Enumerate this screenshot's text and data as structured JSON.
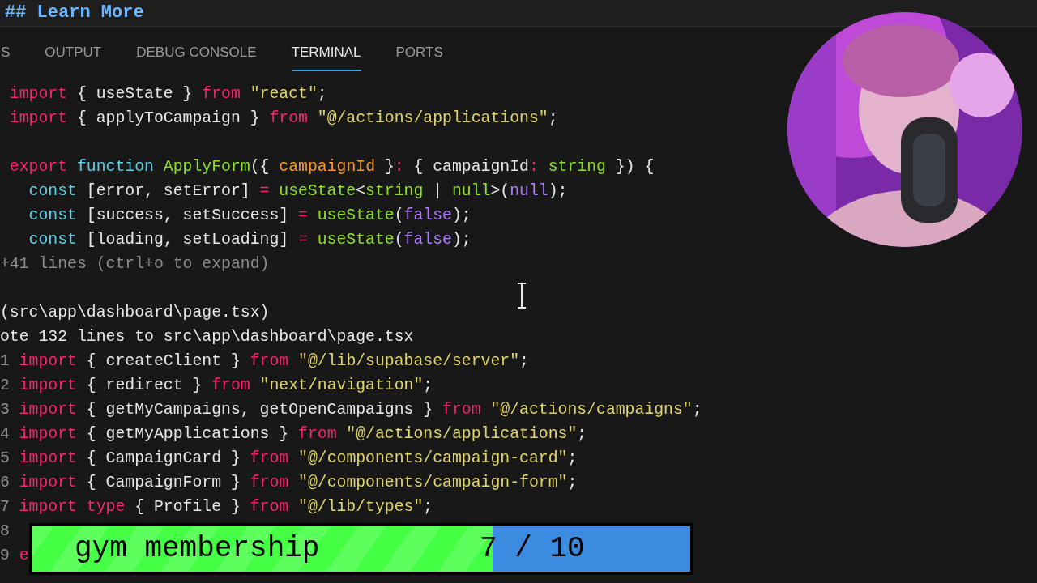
{
  "editor": {
    "heading": "## Learn More"
  },
  "panel": {
    "tabs": [
      {
        "label": "S",
        "selected": false
      },
      {
        "label": "OUTPUT",
        "selected": false
      },
      {
        "label": "DEBUG CONSOLE",
        "selected": false
      },
      {
        "label": "TERMINAL",
        "selected": true
      },
      {
        "label": "PORTS",
        "selected": false
      }
    ]
  },
  "terminal": {
    "lines": [
      {
        "kind": "code",
        "tokens": [
          {
            "kind": "kw",
            "text": " import"
          },
          {
            "kind": "plain",
            "text": " { useState } "
          },
          {
            "kind": "kw",
            "text": "from"
          },
          {
            "kind": "str",
            "text": " \"react\""
          },
          {
            "kind": "plain",
            "text": ";"
          }
        ]
      },
      {
        "kind": "code",
        "tokens": [
          {
            "kind": "kw",
            "text": " import"
          },
          {
            "kind": "plain",
            "text": " { applyToCampaign } "
          },
          {
            "kind": "kw",
            "text": "from"
          },
          {
            "kind": "str",
            "text": " \"@/actions/applications\""
          },
          {
            "kind": "plain",
            "text": ";"
          }
        ]
      },
      {
        "kind": "blank"
      },
      {
        "kind": "code",
        "tokens": [
          {
            "kind": "kw",
            "text": " export"
          },
          {
            "kind": "storage",
            "text": " function"
          },
          {
            "kind": "fn",
            "text": " ApplyForm"
          },
          {
            "kind": "plain",
            "text": "({ "
          },
          {
            "kind": "param",
            "text": "campaignId"
          },
          {
            "kind": "plain",
            "text": " }"
          },
          {
            "kind": "kw",
            "text": ":"
          },
          {
            "kind": "plain",
            "text": " { campaignId"
          },
          {
            "kind": "kw",
            "text": ":"
          },
          {
            "kind": "fn",
            "text": " string"
          },
          {
            "kind": "plain",
            "text": " }) {"
          }
        ]
      },
      {
        "kind": "code",
        "tokens": [
          {
            "kind": "storage",
            "text": "   const"
          },
          {
            "kind": "plain",
            "text": " [error, setError] "
          },
          {
            "kind": "kw",
            "text": "="
          },
          {
            "kind": "fn",
            "text": " useState"
          },
          {
            "kind": "plain",
            "text": "<"
          },
          {
            "kind": "fn",
            "text": "string"
          },
          {
            "kind": "plain",
            "text": " | "
          },
          {
            "kind": "fn",
            "text": "null"
          },
          {
            "kind": "plain",
            "text": ">("
          },
          {
            "kind": "const",
            "text": "null"
          },
          {
            "kind": "plain",
            "text": ");"
          }
        ]
      },
      {
        "kind": "code",
        "tokens": [
          {
            "kind": "storage",
            "text": "   const"
          },
          {
            "kind": "plain",
            "text": " [success, setSuccess] "
          },
          {
            "kind": "kw",
            "text": "="
          },
          {
            "kind": "fn",
            "text": " useState"
          },
          {
            "kind": "plain",
            "text": "("
          },
          {
            "kind": "const",
            "text": "false"
          },
          {
            "kind": "plain",
            "text": ");"
          }
        ]
      },
      {
        "kind": "code",
        "tokens": [
          {
            "kind": "storage",
            "text": "   const"
          },
          {
            "kind": "plain",
            "text": " [loading, setLoading] "
          },
          {
            "kind": "kw",
            "text": "="
          },
          {
            "kind": "fn",
            "text": " useState"
          },
          {
            "kind": "plain",
            "text": "("
          },
          {
            "kind": "const",
            "text": "false"
          },
          {
            "kind": "plain",
            "text": ");"
          }
        ]
      },
      {
        "kind": "code",
        "tokens": [
          {
            "kind": "dim",
            "text": "+41 lines (ctrl+o to expand)"
          }
        ]
      },
      {
        "kind": "blank"
      },
      {
        "kind": "code",
        "tokens": [
          {
            "kind": "plain",
            "text": "(src\\app\\dashboard\\page.tsx)"
          }
        ]
      },
      {
        "kind": "code",
        "tokens": [
          {
            "kind": "plain",
            "text": "ote 132 lines to src\\app\\dashboard\\page.tsx"
          }
        ]
      },
      {
        "kind": "code",
        "tokens": [
          {
            "kind": "dim",
            "text": "1 "
          },
          {
            "kind": "kw",
            "text": "import"
          },
          {
            "kind": "plain",
            "text": " { createClient } "
          },
          {
            "kind": "kw",
            "text": "from"
          },
          {
            "kind": "str",
            "text": " \"@/lib/supabase/server\""
          },
          {
            "kind": "plain",
            "text": ";"
          }
        ]
      },
      {
        "kind": "code",
        "tokens": [
          {
            "kind": "dim",
            "text": "2 "
          },
          {
            "kind": "kw",
            "text": "import"
          },
          {
            "kind": "plain",
            "text": " { redirect } "
          },
          {
            "kind": "kw",
            "text": "from"
          },
          {
            "kind": "str",
            "text": " \"next/navigation\""
          },
          {
            "kind": "plain",
            "text": ";"
          }
        ]
      },
      {
        "kind": "code",
        "tokens": [
          {
            "kind": "dim",
            "text": "3 "
          },
          {
            "kind": "kw",
            "text": "import"
          },
          {
            "kind": "plain",
            "text": " { getMyCampaigns, getOpenCampaigns } "
          },
          {
            "kind": "kw",
            "text": "from"
          },
          {
            "kind": "str",
            "text": " \"@/actions/campaigns\""
          },
          {
            "kind": "plain",
            "text": ";"
          }
        ]
      },
      {
        "kind": "code",
        "tokens": [
          {
            "kind": "dim",
            "text": "4 "
          },
          {
            "kind": "kw",
            "text": "import"
          },
          {
            "kind": "plain",
            "text": " { getMyApplications } "
          },
          {
            "kind": "kw",
            "text": "from"
          },
          {
            "kind": "str",
            "text": " \"@/actions/applications\""
          },
          {
            "kind": "plain",
            "text": ";"
          }
        ]
      },
      {
        "kind": "code",
        "tokens": [
          {
            "kind": "dim",
            "text": "5 "
          },
          {
            "kind": "kw",
            "text": "import"
          },
          {
            "kind": "plain",
            "text": " { CampaignCard } "
          },
          {
            "kind": "kw",
            "text": "from"
          },
          {
            "kind": "str",
            "text": " \"@/components/campaign-card\""
          },
          {
            "kind": "plain",
            "text": ";"
          }
        ]
      },
      {
        "kind": "code",
        "tokens": [
          {
            "kind": "dim",
            "text": "6 "
          },
          {
            "kind": "kw",
            "text": "import"
          },
          {
            "kind": "plain",
            "text": " { CampaignForm } "
          },
          {
            "kind": "kw",
            "text": "from"
          },
          {
            "kind": "str",
            "text": " \"@/components/campaign-form\""
          },
          {
            "kind": "plain",
            "text": ";"
          }
        ]
      },
      {
        "kind": "code",
        "tokens": [
          {
            "kind": "dim",
            "text": "7 "
          },
          {
            "kind": "kw",
            "text": "import type"
          },
          {
            "kind": "plain",
            "text": " { Profile } "
          },
          {
            "kind": "kw",
            "text": "from"
          },
          {
            "kind": "str",
            "text": " \"@/lib/types\""
          },
          {
            "kind": "plain",
            "text": ";"
          }
        ]
      },
      {
        "kind": "code",
        "tokens": [
          {
            "kind": "dim",
            "text": "8"
          }
        ]
      },
      {
        "kind": "code",
        "tokens": [
          {
            "kind": "dim",
            "text": "9 "
          },
          {
            "kind": "kw",
            "text": "e"
          }
        ]
      }
    ]
  },
  "progress": {
    "label": "gym membership",
    "reading": "7 / 10",
    "level": 0.7
  }
}
